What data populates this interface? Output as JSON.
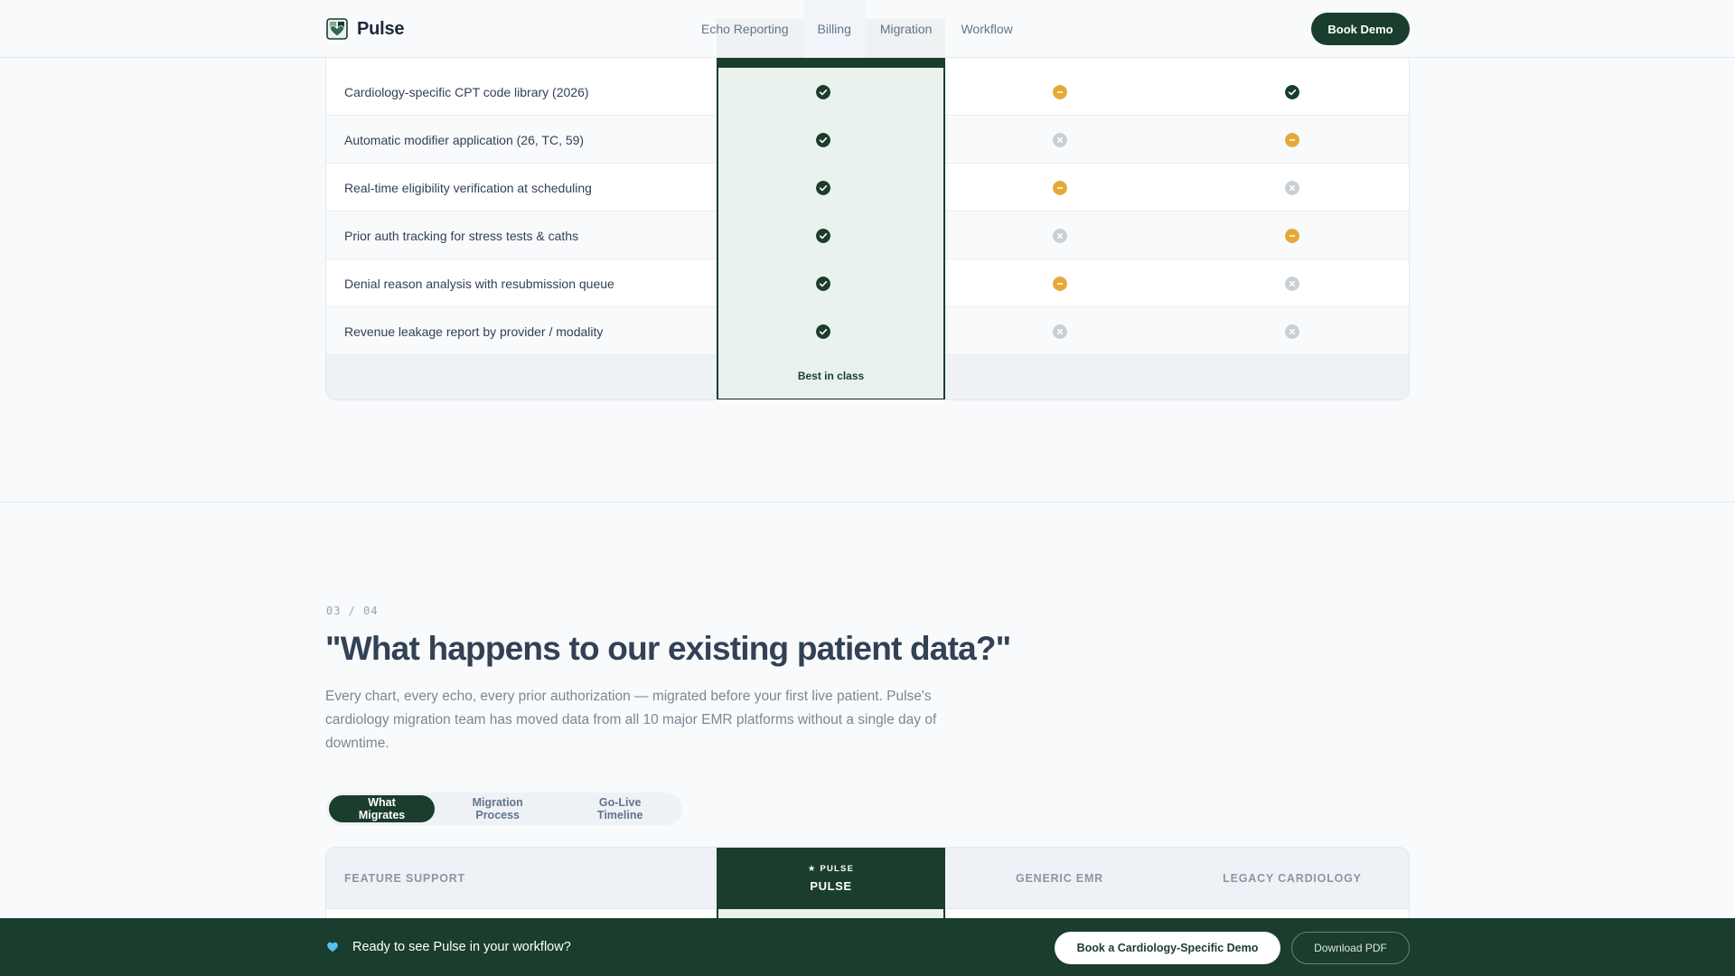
{
  "header": {
    "brand": "Pulse",
    "nav": [
      "Echo Reporting",
      "Billing",
      "Migration",
      "Workflow"
    ],
    "book_demo": "Book Demo"
  },
  "billing_table": {
    "rows": [
      {
        "feature": "Cardiology-specific CPT code library (2026)",
        "pulse": "yes",
        "generic": "partial",
        "legacy": "yes"
      },
      {
        "feature": "Automatic modifier application (26, TC, 59)",
        "pulse": "yes",
        "generic": "no",
        "legacy": "partial"
      },
      {
        "feature": "Real-time eligibility verification at scheduling",
        "pulse": "yes",
        "generic": "partial",
        "legacy": "no"
      },
      {
        "feature": "Prior auth tracking for stress tests & caths",
        "pulse": "yes",
        "generic": "no",
        "legacy": "partial"
      },
      {
        "feature": "Denial reason analysis with resubmission queue",
        "pulse": "yes",
        "generic": "partial",
        "legacy": "no"
      },
      {
        "feature": "Revenue leakage report by provider / modality",
        "pulse": "yes",
        "generic": "no",
        "legacy": "no"
      }
    ],
    "pulse_footer": "Best in class"
  },
  "section": {
    "number": "03 / 04",
    "title": "\"What happens to our existing patient data?\"",
    "description": "Every chart, every echo, every prior authorization — migrated before your first live patient. Pulse's cardiology migration team has moved data from all 10 major EMR platforms without a single day of downtime.",
    "tabs": [
      "What Migrates",
      "Migration Process",
      "Go-Live Timeline"
    ],
    "active_tab": 0
  },
  "migration_table": {
    "col_feature": "FEATURE SUPPORT",
    "pulse_badge": "★ PULSE",
    "col_pulse": "PULSE",
    "col_generic": "GENERIC EMR",
    "col_legacy": "LEGACY CARDIOLOGY"
  },
  "cta": {
    "text": "Ready to see Pulse in your workflow?",
    "primary": "Book a Cardiology-Specific Demo",
    "secondary": "Download PDF"
  },
  "colors": {
    "brand": "#1a3d2e",
    "check": "#1a3d2e",
    "partial": "#e8a838",
    "no": "#c8cfd7",
    "heart": "#5bc0eb"
  }
}
